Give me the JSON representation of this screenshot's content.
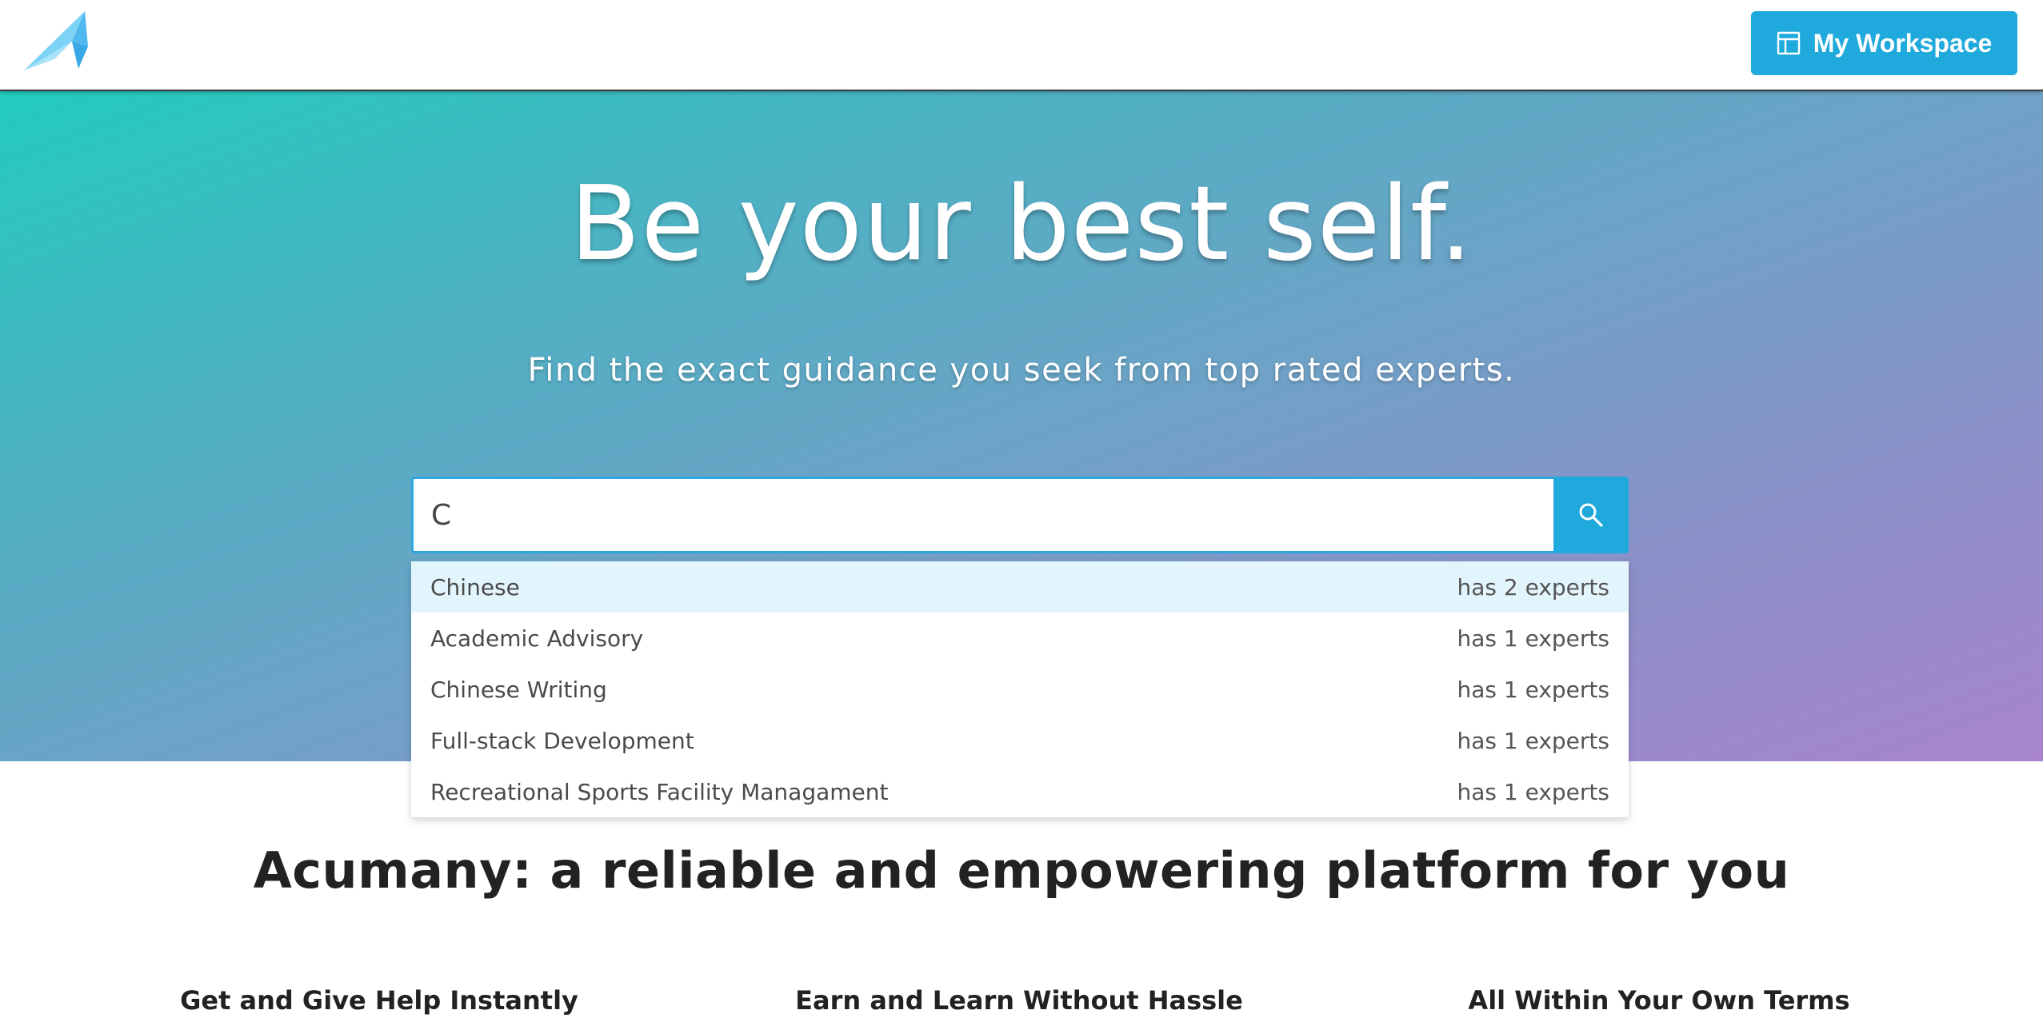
{
  "header": {
    "logo_name": "acumany-logo",
    "workspace_button_label": "My Workspace",
    "workspace_icon": "workspace-layout-icon"
  },
  "hero": {
    "title": "Be your best self.",
    "subtitle": "Find the exact guidance you seek from top rated experts."
  },
  "search": {
    "value": "C",
    "placeholder": "",
    "button_icon": "search-icon"
  },
  "suggestions": [
    {
      "label": "Chinese",
      "count": "has 2 experts",
      "active": true
    },
    {
      "label": "Academic Advisory",
      "count": "has 1 experts",
      "active": false
    },
    {
      "label": "Chinese Writing",
      "count": "has 1 experts",
      "active": false
    },
    {
      "label": "Full-stack Development",
      "count": "has 1 experts",
      "active": false
    },
    {
      "label": "Recreational Sports Facility Managament",
      "count": "has 1 experts",
      "active": false
    }
  ],
  "platform": {
    "heading": "Acumany: a reliable and empowering platform for you",
    "features": [
      "Get and Give Help Instantly",
      "Earn and Learn Without Hassle",
      "All Within Your Own Terms"
    ]
  },
  "colors": {
    "accent": "#1fa9dc",
    "hero_gradient_start": "#22cbbd",
    "hero_gradient_end": "#a884ce",
    "suggestion_highlight": "#e3f5fc"
  }
}
